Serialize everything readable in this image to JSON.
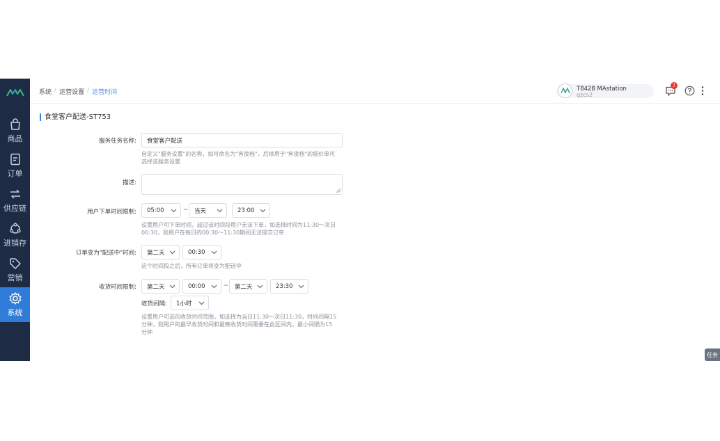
{
  "sidebar": {
    "logo_icon": "brand-logo-icon",
    "items": [
      {
        "label": "商品",
        "icon": "shopping-bag-icon",
        "active": false
      },
      {
        "label": "订单",
        "icon": "document-icon",
        "active": false
      },
      {
        "label": "供应链",
        "icon": "exchange-arrows-icon",
        "active": false
      },
      {
        "label": "进销存",
        "icon": "cycle-icon",
        "active": false
      },
      {
        "label": "营销",
        "icon": "tag-icon",
        "active": false
      },
      {
        "label": "系统",
        "icon": "gear-icon",
        "active": true
      }
    ]
  },
  "breadcrumb": {
    "items": [
      "系统",
      "运营设置",
      "运营时间"
    ],
    "separator": "/"
  },
  "user": {
    "name": "T8428 MAstation",
    "sub": "qzcs2"
  },
  "header": {
    "message_count": "7"
  },
  "page": {
    "title": "食堂客户配送-ST753"
  },
  "form": {
    "service_name": {
      "label": "服务任务名称:",
      "value": "食堂客户配送",
      "hint_line1": "自定义\"服务设置\"的名称，如可命名为\"宵夜档\"，后续用于\"宵夜档\"的报价单可",
      "hint_line2": "选择该服务设置"
    },
    "description": {
      "label": "描述:",
      "value": ""
    },
    "order_time": {
      "label": "用户下单时间限制:",
      "start": "05:00",
      "tilde": "~",
      "end_day": "当天",
      "end_time": "23:00",
      "hint_line1": "设置用户可下单时间，超过该时间段用户无法下单，如选择时间为11:30～次日",
      "hint_line2": "00:30，则用户在每日的00:30～11:30期间无法提交订单"
    },
    "delivering_time": {
      "label": "订单变为\"配送中\"时间:",
      "day": "第二天",
      "time": "00:30",
      "hint": "这个时间段之后，所有订单将变为配送中"
    },
    "receive_time": {
      "label": "收货时间限制:",
      "start_day": "第二天",
      "start_time": "00:00",
      "tilde": "~",
      "end_day": "第二天",
      "end_time": "23:30",
      "interval_label": "收货间隔:",
      "interval": "1小时",
      "hint_line1": "设置用户可选的收货时间范围，如选择为当日11:30～次日11:30，时间间隔15",
      "hint_line2": "分钟，则用户的最早收货时间和最晚收货时间需要在此区间内，最小间隔为15",
      "hint_line3": "分钟"
    }
  },
  "task_tab": "任务",
  "colors": {
    "sidebar_bg": "#1d2b45",
    "active": "#2f7dd8",
    "badge": "#e53935",
    "accent_bar": "#3a86d9"
  }
}
